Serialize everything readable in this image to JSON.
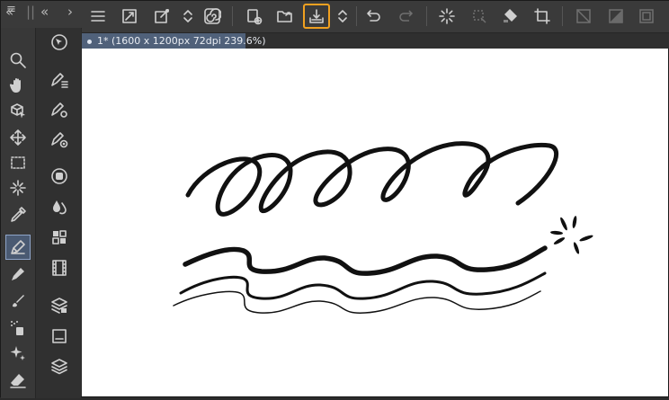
{
  "document": {
    "tab_label": "1* (1600 x 1200px 72dpi 239.6%)"
  },
  "top_left": {
    "collapse_left": "«",
    "collapse_right": "»",
    "collapse_left_2": "«",
    "collapse_right_2": "›"
  },
  "toolbar_icons": [
    "menu-icon",
    "fullscreen-icon",
    "brush-settings-icon",
    "chevron-updown-icon",
    "spiral-icon",
    "new-file-icon",
    "open-folder-icon",
    "export-icon",
    "chevron-updown-icon",
    "undo-icon",
    "redo-icon",
    "loading-spinner-icon",
    "transform-selection-icon",
    "fill-bucket-icon",
    "crop-icon",
    "clear-layer-icon",
    "gradient-icon",
    "frame-icon"
  ],
  "highlighted_tool": "export-icon",
  "tools_left": [
    "zoom-icon",
    "hand-icon",
    "object-select-icon",
    "move-icon",
    "marquee-icon",
    "magic-wand-icon",
    "eyedropper-icon",
    "pen-icon",
    "marker-icon",
    "brush-icon",
    "spray-icon",
    "sparkle-icon",
    "eraser-icon"
  ],
  "active_tool": "pen-icon",
  "subtools": [
    "rotate-view-icon",
    "pen-list-icon",
    "pen-settings-icon",
    "pen-target-icon",
    "layer-circle-icon",
    "droplets-icon",
    "grid-icon",
    "film-icon",
    "layers-3d-icon",
    "panel-icon",
    "layer-stack-icon"
  ],
  "colors": {
    "toolbar_bg": "#3a3a3a",
    "highlight": "#f0a020",
    "tab_bg": "#50617a",
    "active_tool_bg": "#4a5a72",
    "canvas_bg": "#ffffff"
  }
}
